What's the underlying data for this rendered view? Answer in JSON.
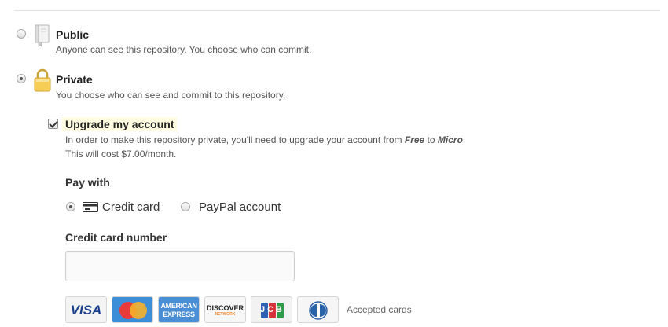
{
  "visibility": {
    "public": {
      "title": "Public",
      "description": "Anyone can see this repository. You choose who can commit.",
      "selected": false,
      "icon": "repo-book-icon"
    },
    "private": {
      "title": "Private",
      "description": "You choose who can see and commit to this repository.",
      "selected": true,
      "icon": "padlock-icon"
    }
  },
  "upgrade": {
    "label": "Upgrade my account",
    "checked": true,
    "line1_pre": "In order to make this repository private, you'll need to upgrade your account from ",
    "from_plan": "Free",
    "to_word": " to ",
    "to_plan": "Micro",
    "line1_post": ".",
    "line2": "This will cost $7.00/month."
  },
  "payment": {
    "heading": "Pay with",
    "options": [
      {
        "label": "Credit card",
        "selected": true,
        "icon": "credit-card-icon"
      },
      {
        "label": "PayPal account",
        "selected": false
      }
    ]
  },
  "credit_card": {
    "label": "Credit card number",
    "value": "",
    "placeholder": ""
  },
  "cards": {
    "visa": "VISA",
    "mastercard": "mastercard-logo",
    "amex_line1": "AMERICAN",
    "amex_line2": "EXPRESS",
    "discover": "DISCOVER",
    "discover_sub": "NETWORK",
    "jcb": "JCB",
    "diners": "diners-club-logo",
    "accepted_label": "Accepted cards"
  },
  "colors": {
    "highlight": "#fffbe0",
    "lock": "#f2c14e",
    "visa_blue": "#1a3e8e",
    "amex_blue": "#4a8ed6",
    "discover_orange": "#f0862b"
  }
}
